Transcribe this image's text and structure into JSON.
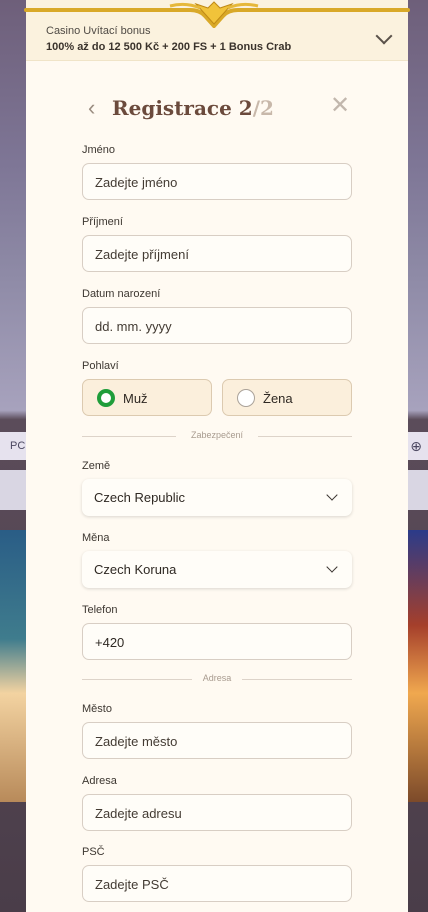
{
  "background": {
    "row_text": "PC",
    "row_icon": "gamepad-icon"
  },
  "bonus": {
    "title": "Casino Uvítací bonus",
    "offer": "100% až do 12 500 Kč + 200 FS + 1 Bonus Crab"
  },
  "header": {
    "title": "Registrace 2",
    "step_suffix": "/2"
  },
  "form": {
    "first_name": {
      "label": "Jméno",
      "placeholder": "Zadejte jméno"
    },
    "last_name": {
      "label": "Příjmení",
      "placeholder": "Zadejte příjmení"
    },
    "birth_date": {
      "label": "Datum narození",
      "placeholder": "dd. mm. yyyy"
    },
    "gender": {
      "label": "Pohlaví",
      "male": "Muž",
      "female": "Žena",
      "selected": "Muž"
    },
    "security_divider": "Zabezpečení",
    "country": {
      "label": "Země",
      "value": "Czech Republic"
    },
    "currency": {
      "label": "Měna",
      "value": "Czech Koruna"
    },
    "phone": {
      "label": "Telefon",
      "value": "+420"
    },
    "address_divider": "Adresa",
    "city": {
      "label": "Město",
      "placeholder": "Zadejte město"
    },
    "address": {
      "label": "Adresa",
      "placeholder": "Zadejte adresu"
    },
    "zip": {
      "label": "PSČ",
      "placeholder": "Zadejte PSČ"
    }
  },
  "colors": {
    "accent_green": "#1f9d3a",
    "title_brown": "#6b4a3c",
    "sheet_bg": "#fffaf2"
  }
}
